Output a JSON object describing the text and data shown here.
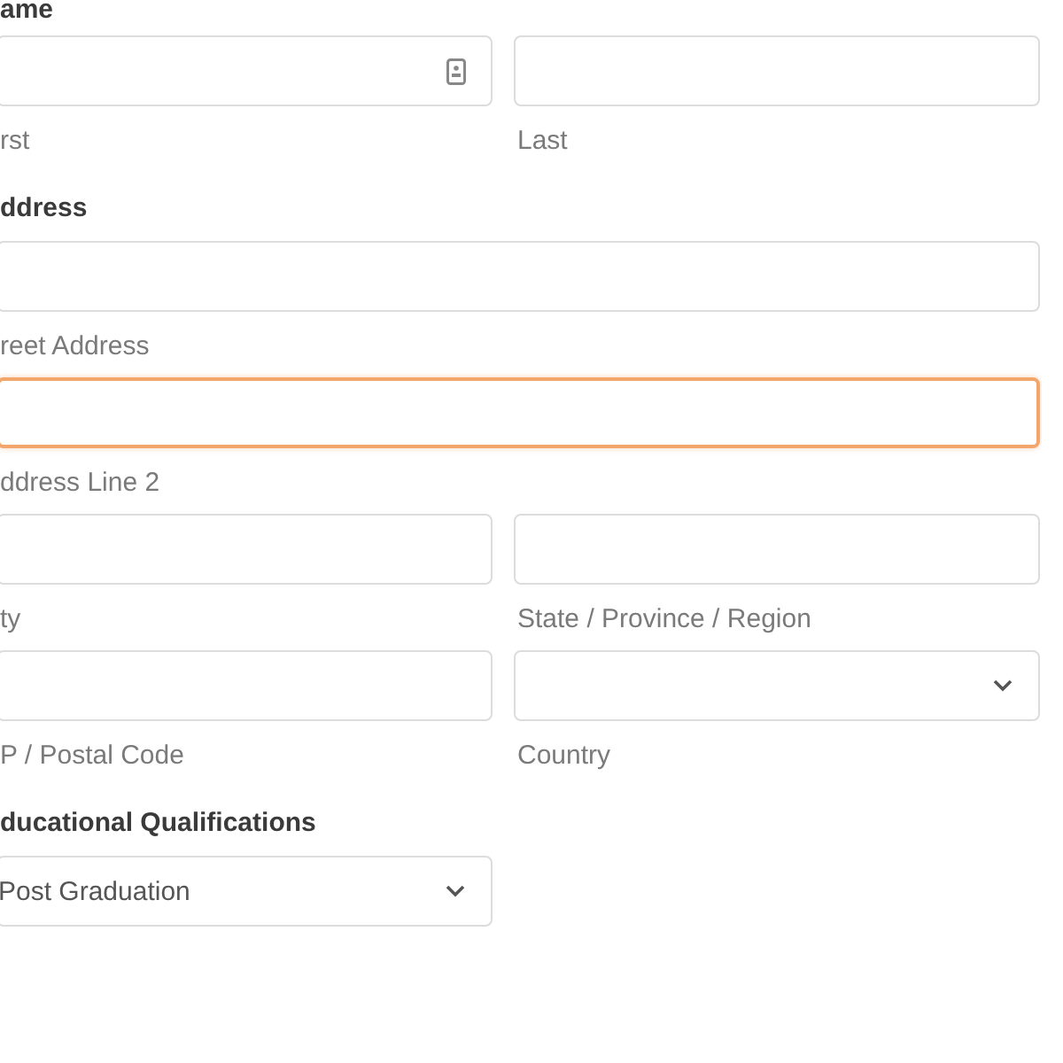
{
  "sections": [
    {
      "heading": "ame",
      "rows": [
        [
          {
            "kind": "text",
            "caption": "rst",
            "wide": false,
            "focused": false,
            "autofill_icon": true
          },
          {
            "kind": "text",
            "caption": "Last",
            "wide": false,
            "focused": false
          }
        ]
      ]
    },
    {
      "heading": "ddress",
      "rows": [
        [
          {
            "kind": "text",
            "caption": "reet Address",
            "wide": true,
            "focused": false
          }
        ],
        [
          {
            "kind": "text",
            "caption": "ddress Line 2",
            "wide": true,
            "focused": true
          }
        ],
        [
          {
            "kind": "text",
            "caption": "ty",
            "wide": false,
            "focused": false
          },
          {
            "kind": "text",
            "caption": "State / Province / Region",
            "wide": false,
            "focused": false
          }
        ],
        [
          {
            "kind": "text",
            "caption": "P / Postal Code",
            "wide": false,
            "focused": false
          },
          {
            "kind": "select",
            "caption": "Country",
            "wide": false,
            "focused": false
          }
        ]
      ]
    },
    {
      "heading": "ducational Qualifications",
      "rows": [
        [
          {
            "kind": "select",
            "value": "Post Graduation",
            "wide": false,
            "focused": false
          }
        ]
      ]
    }
  ]
}
